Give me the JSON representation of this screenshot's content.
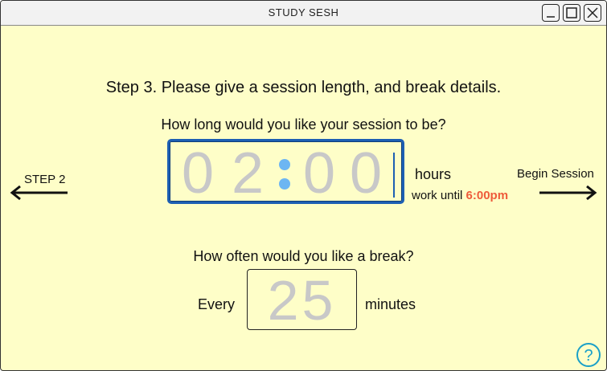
{
  "window": {
    "title": "STUDY SESH",
    "controls": [
      "minimize",
      "maximize",
      "close"
    ]
  },
  "step": {
    "heading": "Step 3. Please give a session length, and break details."
  },
  "session": {
    "question": "How long would you like your session to be?",
    "hours_digits": [
      "0",
      "2"
    ],
    "minutes_digits": [
      "0",
      "0"
    ],
    "unit_label": "hours",
    "work_until_prefix": "work until",
    "work_until_time": "6:00pm"
  },
  "break": {
    "question": "How often would you like a break?",
    "prefix": "Every",
    "value": "25",
    "unit": "minutes"
  },
  "nav": {
    "back_label": "STEP 2",
    "next_label": "Begin Session"
  },
  "help": {
    "icon": "question-mark-icon"
  },
  "colors": {
    "background": "#fefec8",
    "accent": "#1d5fb3",
    "highlight": "#ee5a3a",
    "colon": "#6db6f2"
  }
}
